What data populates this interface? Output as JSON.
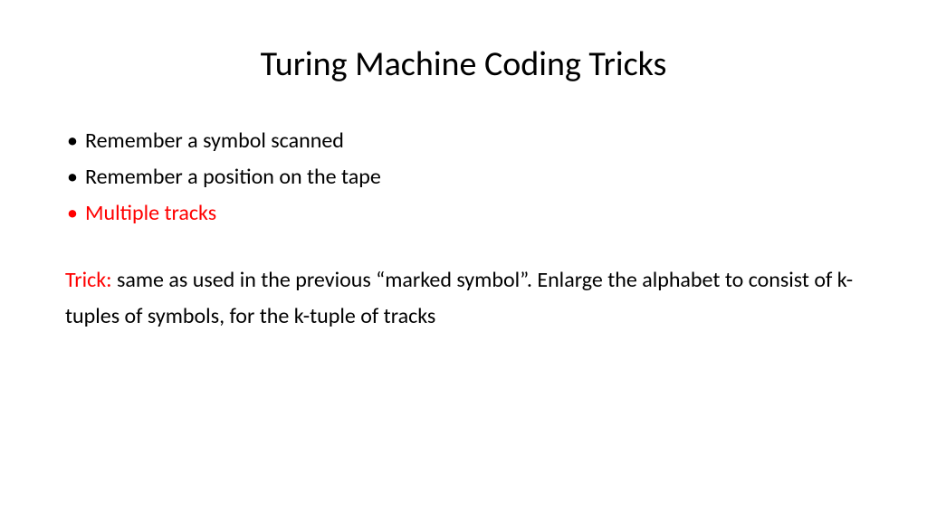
{
  "title": "Turing Machine Coding Tricks",
  "bullets": [
    {
      "text": "Remember a symbol scanned",
      "highlighted": false
    },
    {
      "text": "Remember a position on the tape",
      "highlighted": false
    },
    {
      "text": "Multiple tracks",
      "highlighted": true
    }
  ],
  "trick_label": "Trick:",
  "trick_text": " same as used in the previous “marked symbol”. Enlarge the alphabet  to consist of k-tuples of symbols, for the k-tuple of tracks",
  "colors": {
    "highlight": "#ff0000",
    "text": "#000000",
    "background": "#ffffff"
  }
}
